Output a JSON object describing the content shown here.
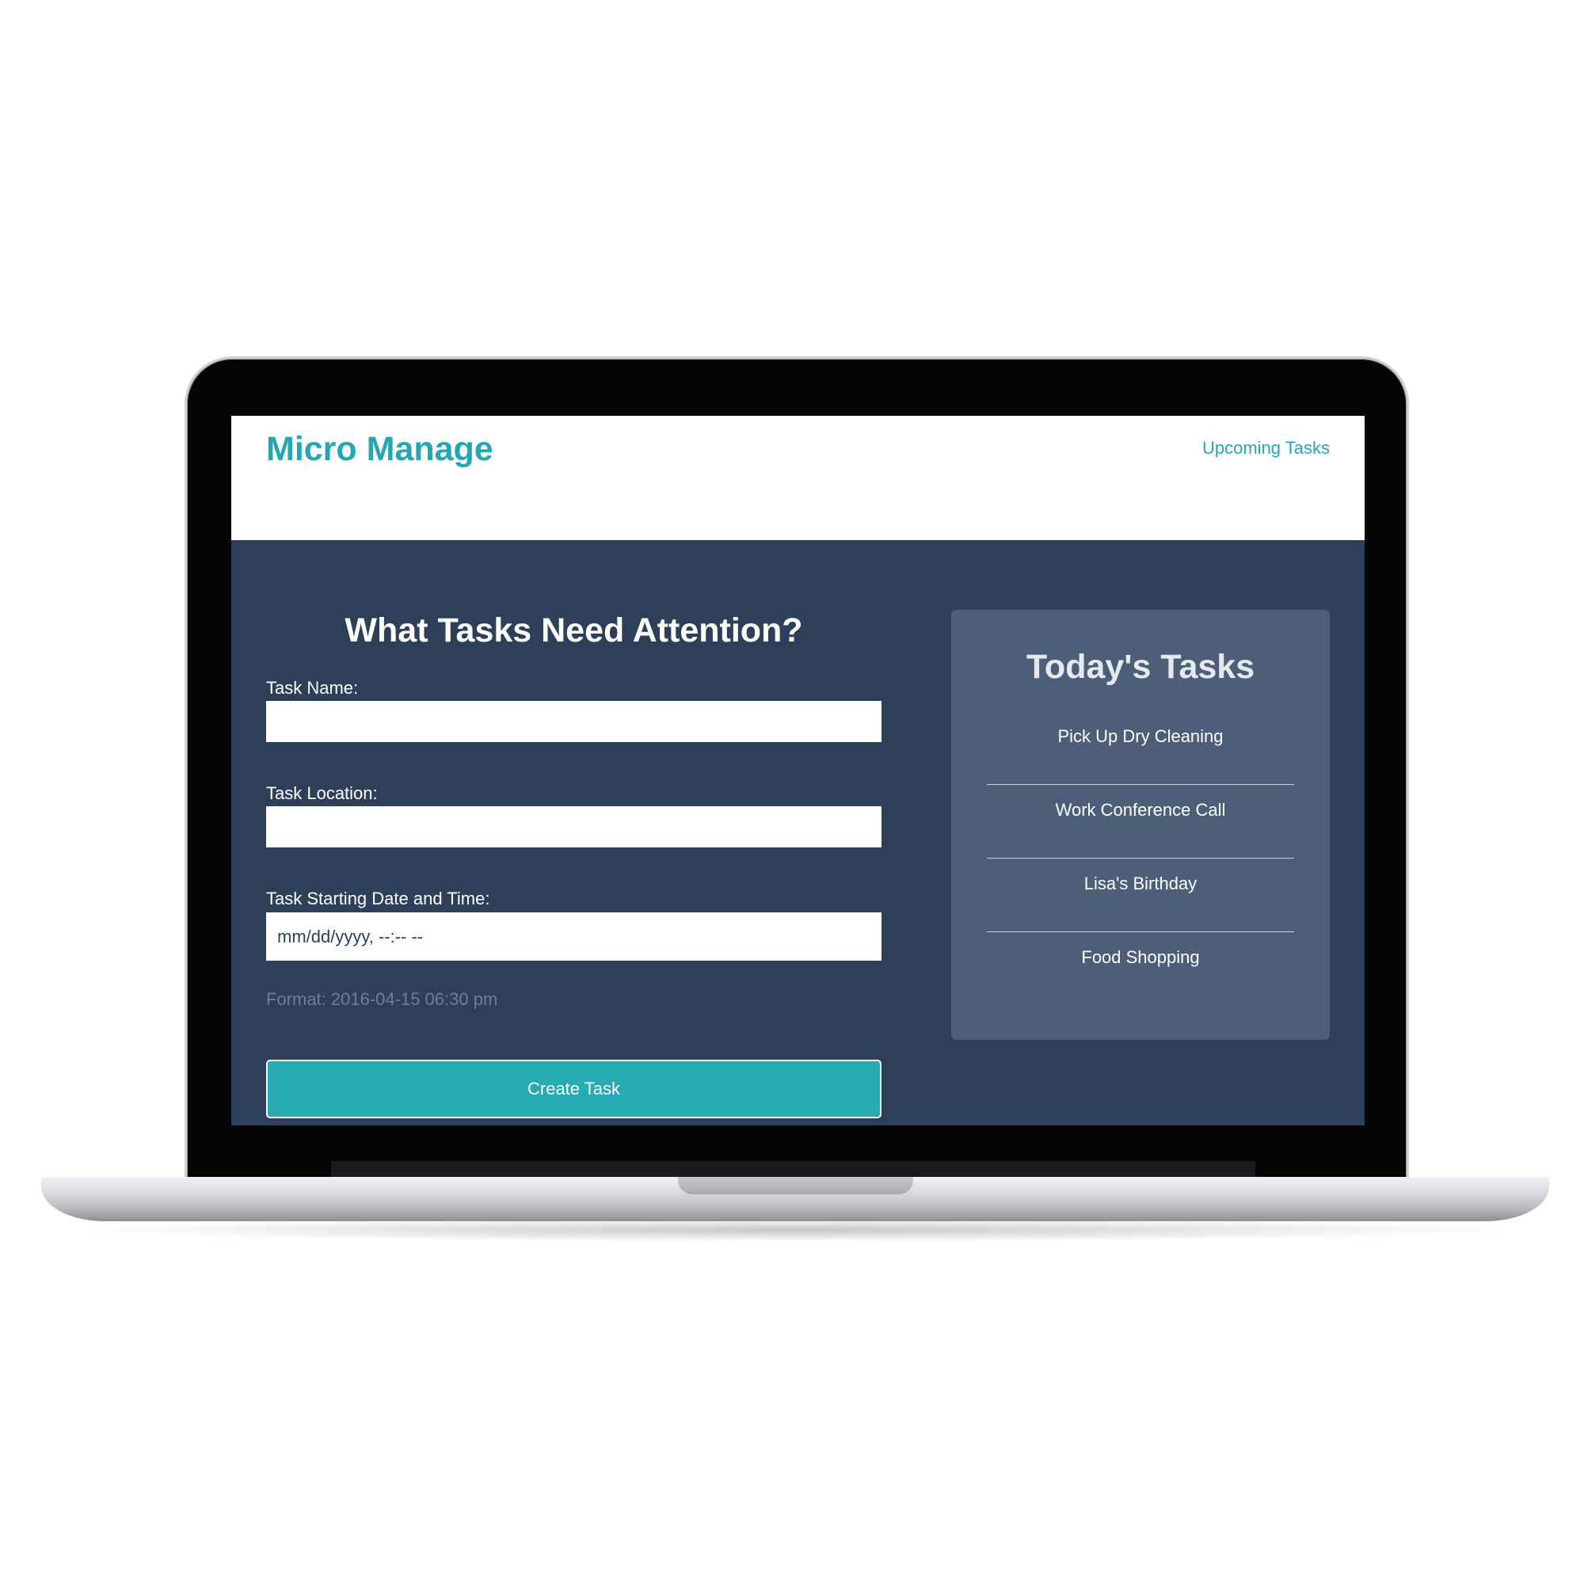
{
  "app": {
    "brand": "Micro Manage",
    "nav_link": "Upcoming Tasks"
  },
  "form": {
    "title": "What Tasks Need Attention?",
    "task_name_label": "Task Name:",
    "task_name_value": "",
    "task_location_label": "Task Location:",
    "task_location_value": "",
    "task_datetime_label": "Task Starting Date and Time:",
    "task_datetime_placeholder": "mm/dd/yyyy, --:-- --",
    "format_hint": "Format: 2016-04-15 06:30 pm",
    "submit_label": "Create Task"
  },
  "today": {
    "title": "Today's Tasks",
    "items": [
      "Pick Up Dry Cleaning",
      "Work Conference Call",
      "Lisa's Birthday",
      "Food Shopping"
    ]
  },
  "colors": {
    "accent": "#26a6b3",
    "page_background": "#2e4059",
    "panel_background": "#4d5f78"
  }
}
